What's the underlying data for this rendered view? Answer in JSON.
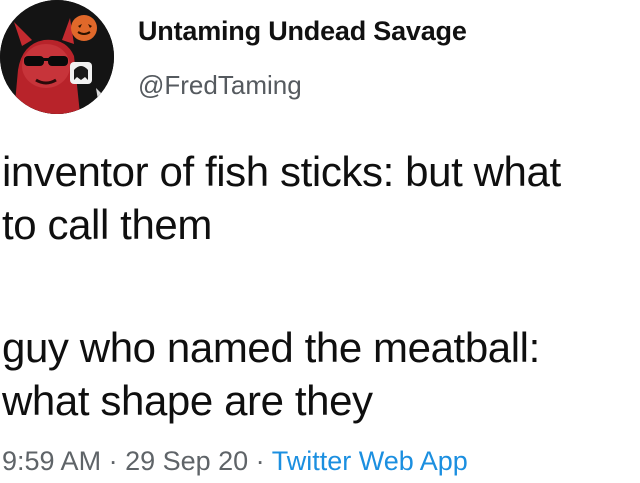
{
  "author": {
    "display_name": "Untaming Undead Savage",
    "handle": "@FredTaming"
  },
  "tweet": {
    "lines_para1": [
      "inventor of fish sticks: but what",
      "to call them"
    ],
    "lines_para2": [
      "guy who named the meatball:",
      "what shape are they"
    ]
  },
  "meta": {
    "time": "9:59 AM",
    "sep1": " · ",
    "date": "29 Sep 20",
    "sep2": " · ",
    "source": "Twitter Web App"
  },
  "colors": {
    "link": "#1b8fe0",
    "secondary_text": "#5f6468"
  }
}
